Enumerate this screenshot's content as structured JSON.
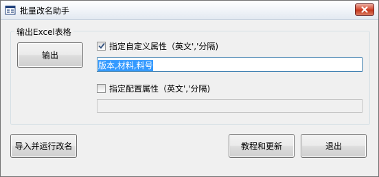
{
  "window": {
    "title": "批量改名助手",
    "icon": "rename-app-icon",
    "close_icon": "close-icon"
  },
  "group": {
    "title": "输出Excel表格",
    "export_button": "输出",
    "custom_attrs": {
      "checked": true,
      "label": "指定自定义属性（英文','分隔)",
      "value": "版本,材料,料号"
    },
    "config_attrs": {
      "checked": false,
      "label": "指定配置属性（英文','分隔)",
      "value": ""
    }
  },
  "footer": {
    "import_run_button": "导入并运行改名",
    "tutorial_button": "教程和更新",
    "exit_button": "退出"
  }
}
